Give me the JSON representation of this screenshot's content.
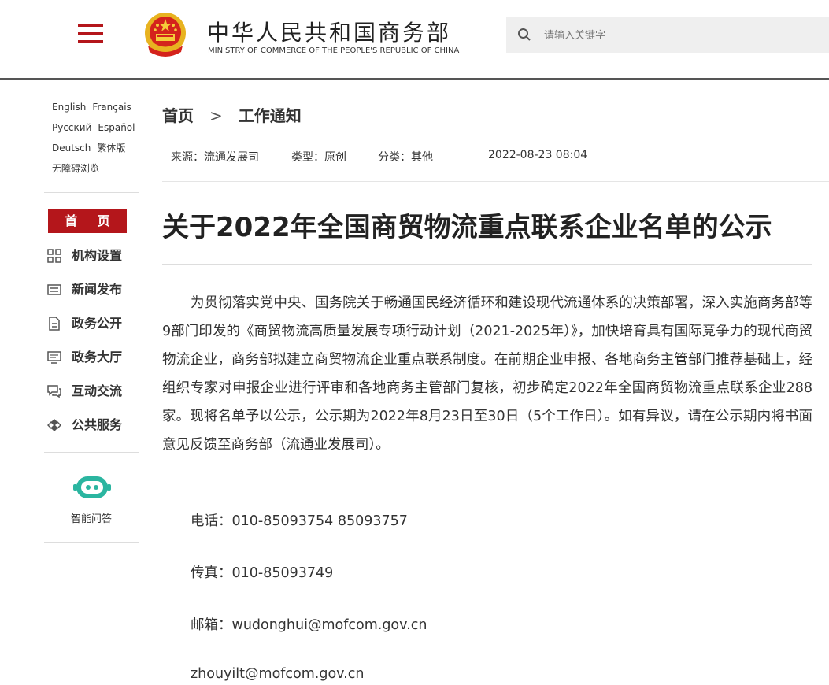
{
  "header": {
    "title": "中华人民共和国商务部",
    "subtitle": "MINISTRY OF COMMERCE OF THE PEOPLE'S REPUBLIC OF CHINA",
    "search_placeholder": "请输入关键字",
    "accent_color": "#b4161b"
  },
  "sidebar": {
    "languages": [
      "English",
      "Français",
      "Русский",
      "Español",
      "Deutsch",
      "繁体版",
      "无障碍浏览"
    ],
    "home": "首 页",
    "nav": [
      {
        "label": "机构设置",
        "icon": "grid-icon"
      },
      {
        "label": "新闻发布",
        "icon": "news-icon"
      },
      {
        "label": "政务公开",
        "icon": "document-icon"
      },
      {
        "label": "政务大厅",
        "icon": "monitor-icon"
      },
      {
        "label": "互动交流",
        "icon": "chat-icon"
      },
      {
        "label": "公共服务",
        "icon": "service-icon"
      }
    ],
    "assistant_label": "智能问答"
  },
  "breadcrumb": {
    "home": "首页",
    "separator": ">",
    "current": "工作通知"
  },
  "meta": {
    "source": "来源：流通发展司",
    "type": "类型：原创",
    "category": "分类：其他",
    "date": "2022-08-23 08:04"
  },
  "article": {
    "title": "关于2022年全国商贸物流重点联系企业名单的公示",
    "body": "为贯彻落实党中央、国务院关于畅通国民经济循环和建设现代流通体系的决策部署，深入实施商务部等9部门印发的《商贸物流高质量发展专项行动计划（2021-2025年）》，加快培育具有国际竞争力的现代商贸物流企业，商务部拟建立商贸物流企业重点联系制度。在前期企业申报、各地商务主管部门推荐基础上，经组织专家对申报企业进行评审和各地商务主管部门复核，初步确定2022年全国商贸物流重点联系企业288家。现将名单予以公示，公示期为2022年8月23日至30日（5个工作日）。如有异议，请在公示期内将书面意见反馈至商务部（流通业发展司）。",
    "phone": "电话：010-85093754 85093757",
    "fax": "传真：010-85093749",
    "email1": "邮箱：wudonghui@mofcom.gov.cn",
    "email2": "zhouyilt@mofcom.gov.cn"
  }
}
